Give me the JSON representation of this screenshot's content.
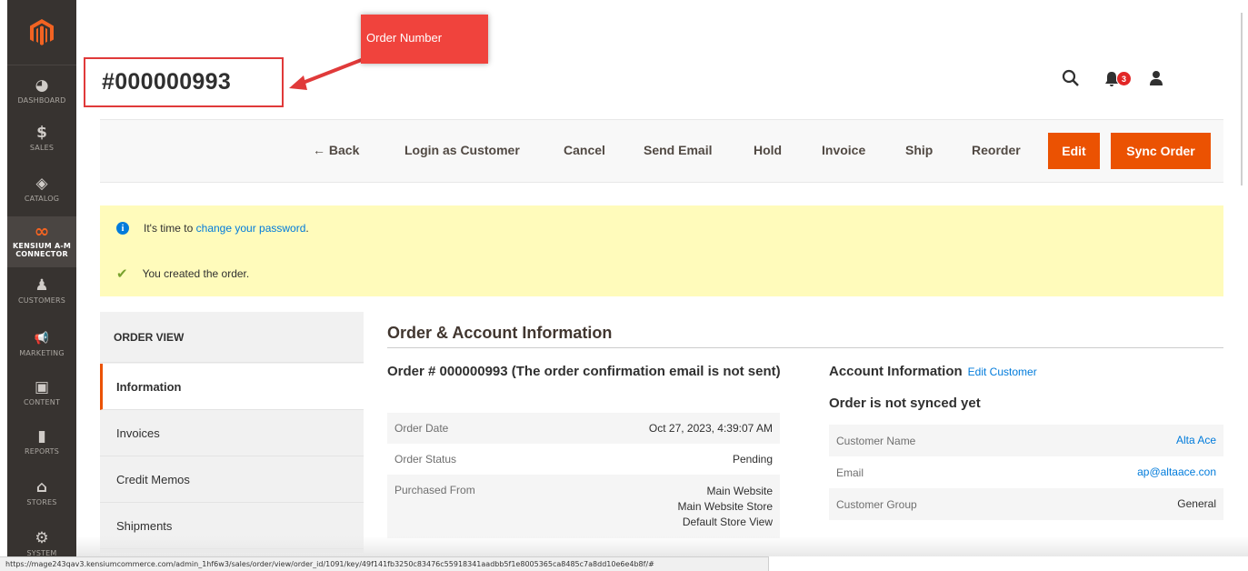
{
  "sidebar": {
    "items": [
      {
        "label": "DASHBOARD",
        "icon": "dashboard-icon",
        "glyph": "◕"
      },
      {
        "label": "SALES",
        "icon": "dollar-icon",
        "glyph": "$"
      },
      {
        "label": "CATALOG",
        "icon": "box-icon",
        "glyph": "◈"
      },
      {
        "label": "KENSIUM A-M CONNECTOR",
        "icon": "kensium-logo-icon",
        "glyph": "∞"
      },
      {
        "label": "CUSTOMERS",
        "icon": "person-icon",
        "glyph": "♟"
      },
      {
        "label": "MARKETING",
        "icon": "megaphone-icon",
        "glyph": "📢"
      },
      {
        "label": "CONTENT",
        "icon": "layout-icon",
        "glyph": "▣"
      },
      {
        "label": "REPORTS",
        "icon": "bar-chart-icon",
        "glyph": "▮"
      },
      {
        "label": "STORES",
        "icon": "storefront-icon",
        "glyph": "⌂"
      },
      {
        "label": "SYSTEM",
        "icon": "gear-icon",
        "glyph": "⚙"
      }
    ]
  },
  "header": {
    "order_title": "#000000993",
    "callout": "Order Number",
    "notification_count": "3"
  },
  "toolbar": {
    "back": "← Back",
    "login_as_customer": "Login as Customer",
    "cancel": "Cancel",
    "send_email": "Send Email",
    "hold": "Hold",
    "invoice": "Invoice",
    "ship": "Ship",
    "reorder": "Reorder",
    "edit": "Edit",
    "sync_order": "Sync Order"
  },
  "messages": {
    "password_prefix": "It's time to ",
    "password_link": "change your password",
    "password_suffix": ".",
    "created": "You created the order."
  },
  "tabs": {
    "heading": "ORDER VIEW",
    "items": [
      "Information",
      "Invoices",
      "Credit Memos",
      "Shipments"
    ]
  },
  "main": {
    "section_title": "Order & Account Information",
    "order": {
      "title": "Order # 000000993 (The order confirmation email is not sent)",
      "rows": [
        {
          "label": "Order Date",
          "value": "Oct 27, 2023, 4:39:07 AM"
        },
        {
          "label": "Order Status",
          "value": "Pending"
        },
        {
          "label": "Purchased From",
          "value_lines": [
            "Main Website",
            "Main Website Store",
            "Default Store View"
          ]
        }
      ]
    },
    "account": {
      "title": "Account Information",
      "edit_link": "Edit Customer",
      "sync_status": "Order is not synced yet",
      "rows": [
        {
          "label": "Customer Name",
          "value": "Alta Ace"
        },
        {
          "label": "Email",
          "value": "ap@altaace.con"
        },
        {
          "label": "Customer Group",
          "value": "General"
        }
      ]
    }
  },
  "statusbar": {
    "url": "https://mage243qav3.kensiumcommerce.com/admin_1hf6w3/sales/order/view/order_id/1091/key/49f141fb3250c83476c55918341aadbb5f1e8005365ca8485c7a8dd10e6e4b8f/#"
  },
  "colors": {
    "accent": "#eb5202",
    "callout": "#f0433d",
    "message_bg": "#fffbbb",
    "link": "#007bdb",
    "sidebar_bg": "#373330"
  }
}
